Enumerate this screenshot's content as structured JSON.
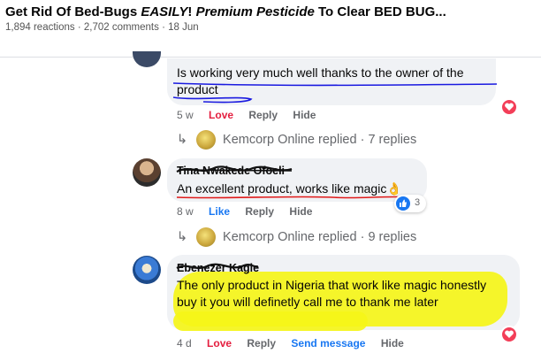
{
  "post": {
    "title_parts": [
      "Get Rid Of Bed-Bugs ",
      "EASILY",
      "! ",
      "Premium Pesticide",
      " To Clear BED BUG..."
    ],
    "meta": "1,894 reactions · 2,702 comments · 18 Jun"
  },
  "comments": [
    {
      "text": "Is working very much well thanks to the owner of the product",
      "time": "5 w",
      "love": "Love",
      "reply": "Reply",
      "hide": "Hide",
      "replies": "Kemcorp Online replied · 7 replies"
    },
    {
      "author": "Tina Nwakede Ofoeli",
      "text": "An excellent product, works like magic👌",
      "time": "8 w",
      "like": "Like",
      "reply": "Reply",
      "hide": "Hide",
      "reaction_count": "3",
      "replies": "Kemcorp Online replied · 9 replies"
    },
    {
      "author": "Ebenezer Kagle",
      "text": "The only product in Nigeria that work like magic honestly buy it you will definetly call me to thank me later",
      "time": "4 d",
      "love": "Love",
      "reply": "Reply",
      "send": "Send message",
      "hide": "Hide"
    }
  ],
  "colors": {
    "love": "#e41e3f",
    "link": "#1877f2",
    "highlight": "#f5f518",
    "scribble_blue": "#1a1ae0",
    "scribble_red": "#e01a1a"
  }
}
